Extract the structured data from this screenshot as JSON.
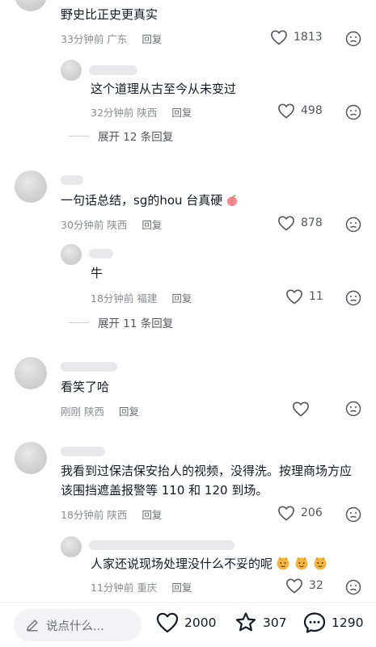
{
  "comments": [
    {
      "text": "野史比正史更真实",
      "time": "33分钟前",
      "location": "广东",
      "reply_label": "回复",
      "likes": "1813"
    },
    {
      "text": "这个道理从古至今从未变过",
      "time": "32分钟前",
      "location": "陕西",
      "reply_label": "回复",
      "likes": "498",
      "expand_label": "展开 12 条回复"
    },
    {
      "text": "一句话总结，sg的hou 台真硬",
      "time": "30分钟前",
      "location": "陕西",
      "reply_label": "回复",
      "likes": "878"
    },
    {
      "text": "牛",
      "time": "18分钟前",
      "location": "福建",
      "reply_label": "回复",
      "likes": "11",
      "expand_label": "展开 11 条回复"
    },
    {
      "text": "看笑了哈",
      "time": "刚刚",
      "location": "陕西",
      "reply_label": "回复",
      "likes": ""
    },
    {
      "text": "我看到过保洁保安抬人的视频，没得洗。按理商场方应该围挡遮盖报警等 110 和 120 到场。",
      "time": "18分钟前",
      "location": "陕西",
      "reply_label": "回复",
      "likes": "206"
    },
    {
      "text": "人家还说现场处理没什么不妥的呢",
      "time": "11分钟前",
      "location": "重庆",
      "reply_label": "回复",
      "likes": "32"
    }
  ],
  "bottom_bar": {
    "placeholder": "说点什么...",
    "like_count": "2000",
    "fav_count": "307",
    "comment_count": "1290"
  },
  "icons": {
    "like": "heart-outline-icon",
    "dislike": "frown-face-icon",
    "emoji_peach": "peach-emoji-icon",
    "emoji_face": "cat-face-emoji-icon",
    "favorite": "star-outline-icon",
    "comment": "speech-bubble-icon",
    "edit": "pencil-icon"
  }
}
